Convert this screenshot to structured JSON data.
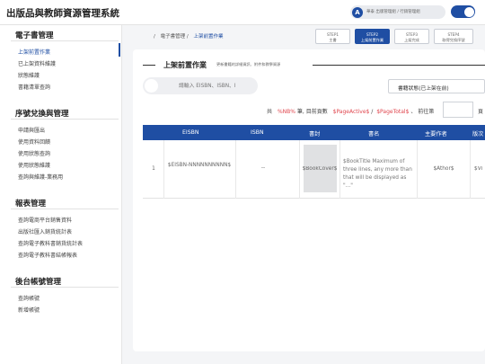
{
  "app": {
    "title": "出版品與教師資源管理系統"
  },
  "user": {
    "avatar_letter": "A",
    "label": "華泰 出版管理組 / 行銷管理組"
  },
  "sidebar": {
    "sections": [
      {
        "title": "電子書管理",
        "items": [
          "上架前置作業",
          "已上架資料維護",
          "狀態維護",
          "書籍清單查詢"
        ]
      },
      {
        "title": "序號兌換與管理",
        "items": [
          "申請與匯出",
          "使用資料回饋",
          "使用狀態查詢",
          "使用狀態維護",
          "查詢與維護-業務用"
        ]
      },
      {
        "title": "報表管理",
        "items": [
          "查詢電商平台銷售資料",
          "出版社匯入銷貨統計表",
          "查詢電子教科書銷貨統計表",
          "查詢電子教科書結帳報表"
        ]
      },
      {
        "title": "後台帳號管理",
        "items": [
          "查詢帳號",
          "新增帳號"
        ]
      }
    ],
    "active_item": "上架前置作業"
  },
  "breadcrumb": {
    "sep1": "/",
    "parent": "電子書管理",
    "sep2": "/",
    "current": "上架前置作業"
  },
  "steps": [
    {
      "num": "STEP1",
      "label": "主書"
    },
    {
      "num": "STEP2",
      "label": "上架前置作業"
    },
    {
      "num": "STEP3",
      "label": "上架完成"
    },
    {
      "num": "STEP4",
      "label": "取得兌換序號"
    }
  ],
  "active_step": 1,
  "card": {
    "title": "上架前置作業",
    "subtitle": "更新書籍的詳細資訊、附件和教學資源"
  },
  "search": {
    "placeholder": "請輸入 EISBN、ISBN、I"
  },
  "filter": {
    "selected": "書籍狀態(已上架在前)"
  },
  "pager": {
    "prefix": "共",
    "total_var": "%NB%",
    "mid1": "筆, 目前頁數",
    "page_var": "$PageActive$",
    "slash": "/",
    "total_pages_var": "$PageTotal$",
    "mid2": "、 前往第",
    "suffix": "頁"
  },
  "table": {
    "headers": [
      "EISBN",
      "ISBN",
      "書封",
      "書名",
      "主要作者",
      "版次"
    ],
    "rows": [
      {
        "index": "1",
        "eisbn": "$EISBN-NNNNNNNNNN$",
        "isbn": "--",
        "cover": "$BookCover$",
        "title": "$BookTitle Maximum of three lines, any more than that will be displayed as \"...\"",
        "author": "$Athor$",
        "edition": "$Vi"
      }
    ]
  },
  "colors": {
    "brand": "#1f4ea3",
    "variable": "#e0464e",
    "background": "#f4f5f7"
  }
}
